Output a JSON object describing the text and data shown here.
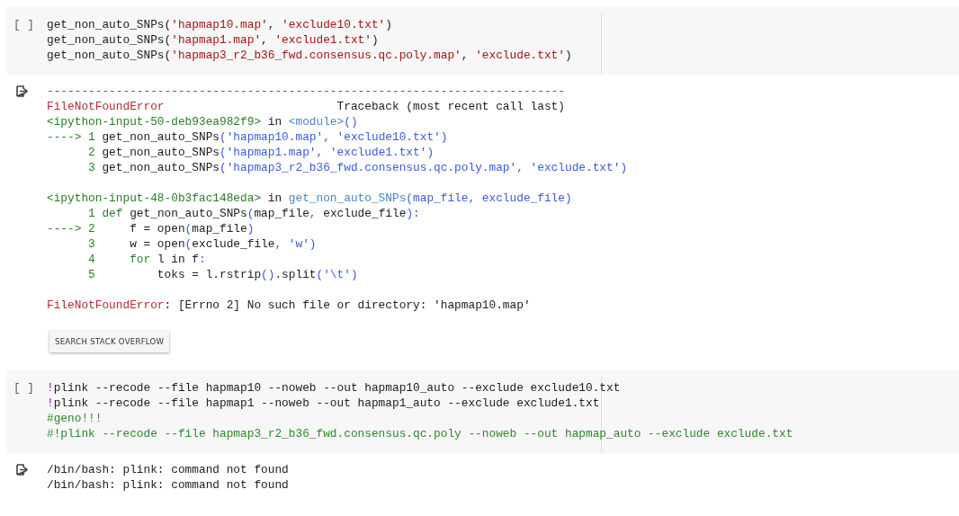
{
  "cells": [
    {
      "gutter": "[ ]",
      "lines": [
        [
          {
            "kind": "plain",
            "text": "get_non_auto_SNPs("
          },
          {
            "kind": "string",
            "text": "'hapmap10.map'"
          },
          {
            "kind": "plain",
            "text": ", "
          },
          {
            "kind": "string",
            "text": "'exclude10.txt'"
          },
          {
            "kind": "plain",
            "text": ")"
          }
        ],
        [
          {
            "kind": "plain",
            "text": "get_non_auto_SNPs("
          },
          {
            "kind": "string",
            "text": "'hapmap1.map'"
          },
          {
            "kind": "plain",
            "text": ", "
          },
          {
            "kind": "string",
            "text": "'exclude1.txt'"
          },
          {
            "kind": "plain",
            "text": ")"
          }
        ],
        [
          {
            "kind": "plain",
            "text": "get_non_auto_SNPs("
          },
          {
            "kind": "string",
            "text": "'hapmap3_r2_b36_fwd.consensus.qc.poly.map'"
          },
          {
            "kind": "plain",
            "text": ", "
          },
          {
            "kind": "string",
            "text": "'exclude.txt'"
          },
          {
            "kind": "plain",
            "text": ")"
          }
        ]
      ],
      "output": {
        "blocks": [
          [
            [
              {
                "kind": "error",
                "text": "---------------------------------------------------------------------------"
              }
            ],
            [
              {
                "kind": "error",
                "text": "FileNotFoundError"
              },
              {
                "kind": "plain",
                "text": "                         Traceback (most recent call last)"
              }
            ],
            [
              {
                "kind": "green",
                "text": "<ipython-input-50-deb93ea982f9>"
              },
              {
                "kind": "plain",
                "text": " in "
              },
              {
                "kind": "link",
                "text": "<module>"
              },
              {
                "kind": "blue",
                "text": "()"
              }
            ],
            [
              {
                "kind": "green",
                "text": "----> 1 "
              },
              {
                "kind": "plain",
                "text": "get_non_auto_SNPs"
              },
              {
                "kind": "blue",
                "text": "('hapmap10.map', 'exclude10.txt')"
              }
            ],
            [
              {
                "kind": "green",
                "text": "      2 "
              },
              {
                "kind": "plain",
                "text": "get_non_auto_SNPs"
              },
              {
                "kind": "blue",
                "text": "('hapmap1.map', 'exclude1.txt')"
              }
            ],
            [
              {
                "kind": "green",
                "text": "      3 "
              },
              {
                "kind": "plain",
                "text": "get_non_auto_SNPs"
              },
              {
                "kind": "blue",
                "text": "('hapmap3_r2_b36_fwd.consensus.qc.poly.map', 'exclude.txt')"
              }
            ]
          ],
          [
            [
              {
                "kind": "green",
                "text": "<ipython-input-48-0b3fac148eda>"
              },
              {
                "kind": "plain",
                "text": " in "
              },
              {
                "kind": "link",
                "text": "get_non_auto_SNPs"
              },
              {
                "kind": "blue",
                "text": "(map_file, exclude_file)"
              }
            ],
            [
              {
                "kind": "green",
                "text": "      1 def"
              },
              {
                "kind": "plain",
                "text": " get_non_auto_SNPs"
              },
              {
                "kind": "blue",
                "text": "("
              },
              {
                "kind": "plain",
                "text": "map_file"
              },
              {
                "kind": "blue",
                "text": ","
              },
              {
                "kind": "plain",
                "text": " exclude_file"
              },
              {
                "kind": "blue",
                "text": "):"
              }
            ],
            [
              {
                "kind": "green",
                "text": "----> 2 "
              },
              {
                "kind": "plain",
                "text": "    f = open"
              },
              {
                "kind": "blue",
                "text": "("
              },
              {
                "kind": "plain",
                "text": "map_file"
              },
              {
                "kind": "blue",
                "text": ")"
              }
            ],
            [
              {
                "kind": "green",
                "text": "      3 "
              },
              {
                "kind": "plain",
                "text": "    w = open"
              },
              {
                "kind": "blue",
                "text": "("
              },
              {
                "kind": "plain",
                "text": "exclude_file"
              },
              {
                "kind": "blue",
                "text": ", 'w')"
              }
            ],
            [
              {
                "kind": "green",
                "text": "      4     for"
              },
              {
                "kind": "plain",
                "text": " l in f"
              },
              {
                "kind": "blue",
                "text": ":"
              }
            ],
            [
              {
                "kind": "green",
                "text": "      5 "
              },
              {
                "kind": "plain",
                "text": "        toks = l.rstrip"
              },
              {
                "kind": "blue",
                "text": "()"
              },
              {
                "kind": "plain",
                "text": ".split"
              },
              {
                "kind": "blue",
                "text": "('\\t')"
              }
            ]
          ],
          [
            [
              {
                "kind": "error",
                "text": "FileNotFoundError"
              },
              {
                "kind": "plain",
                "text": ": [Errno 2] No such file or directory: 'hapmap10.map'"
              }
            ]
          ]
        ],
        "button": "SEARCH STACK OVERFLOW"
      }
    },
    {
      "gutter": "[ ]",
      "lines": [
        [
          {
            "kind": "magic",
            "text": "!"
          },
          {
            "kind": "plain",
            "text": "plink --recode --file hapmap10 --noweb --out hapmap10_auto --exclude exclude10.txt"
          }
        ],
        [
          {
            "kind": "magic",
            "text": "!"
          },
          {
            "kind": "plain",
            "text": "plink --recode --file hapmap1 --noweb --out hapmap1_auto --exclude exclude1.txt"
          }
        ],
        [
          {
            "kind": "comment",
            "text": "#geno!!!"
          }
        ],
        [
          {
            "kind": "comment",
            "text": "#!plink --recode --file hapmap3_r2_b36_fwd.consensus.qc.poly --noweb --out hapmap_auto --exclude exclude.txt"
          }
        ]
      ],
      "output": {
        "blocks": [
          [
            [
              {
                "kind": "plain",
                "text": "/bin/bash: plink: command not found"
              }
            ],
            [
              {
                "kind": "plain",
                "text": "/bin/bash: plink: command not found"
              }
            ]
          ]
        ]
      }
    }
  ]
}
